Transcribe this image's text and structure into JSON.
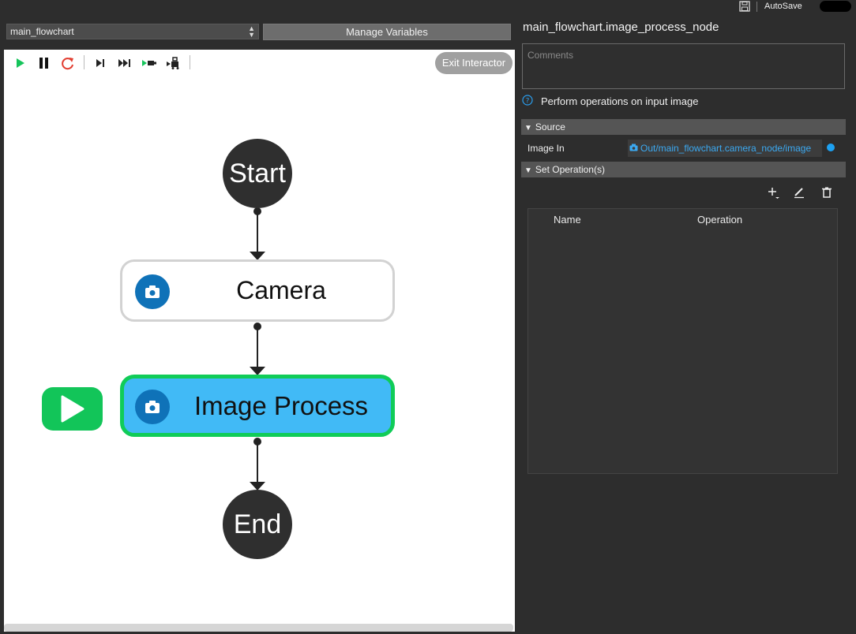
{
  "topbar": {
    "autosave_label": "AutoSave"
  },
  "header": {
    "flowchart_select": "main_flowchart",
    "manage_variables_label": "Manage Variables"
  },
  "toolbar": {
    "exit_interactor_label": "Exit Interactor",
    "icons": [
      "play-icon",
      "pause-icon",
      "reset-icon",
      "step-icon",
      "fast-forward-icon",
      "step-into-icon",
      "run-to-icon"
    ]
  },
  "flowchart": {
    "start_label": "Start",
    "end_label": "End",
    "nodes": [
      {
        "label": "Camera",
        "icon": "camera-icon"
      },
      {
        "label": "Image Process",
        "icon": "camera-icon"
      }
    ],
    "colors": {
      "active_fill": "#41baf6",
      "active_border": "#10cc58",
      "terminal": "#2f2f2f"
    }
  },
  "panel": {
    "title": "main_flowchart.image_process_node",
    "comments_placeholder": "Comments",
    "description": "Perform operations on input image",
    "source_section": "Source",
    "image_in_label": "Image In",
    "image_in_value": "Out/main_flowchart.camera_node/image",
    "operations_section": "Set Operation(s)",
    "table_headers": [
      "Name",
      "Operation"
    ]
  }
}
